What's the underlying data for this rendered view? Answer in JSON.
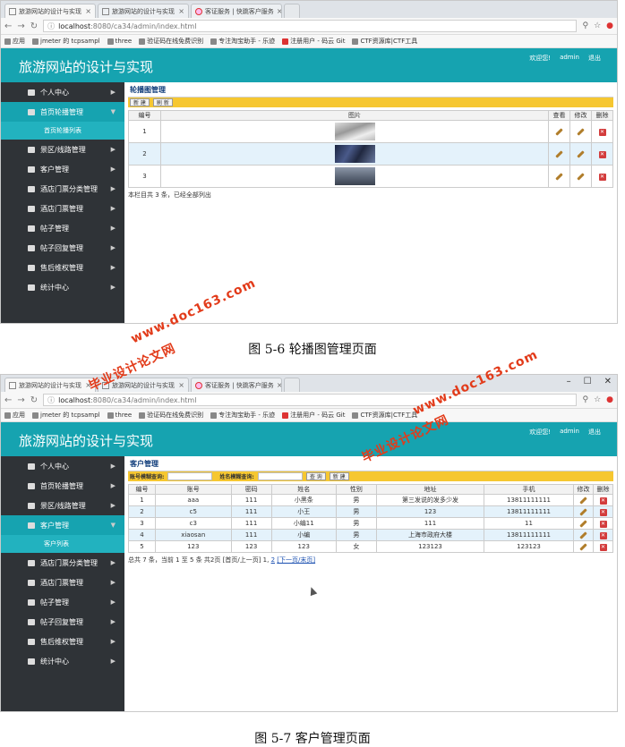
{
  "browser": {
    "tabs": [
      "旅游网站的设计与实现",
      "旅游网站的设计与实现",
      "客证服务 | 快跳客户服务"
    ],
    "address_host": "localhost",
    "address_path": ":8080/ca34/admin/index.html",
    "bookmarks": [
      "应用",
      "jmeter 的 tcpsampl",
      "three",
      "验证码在线免费识别",
      "专注淘宝助手 - 乐迹",
      "注册用户 - 码云 Git",
      "CTF资源库|CTF工具"
    ]
  },
  "header": {
    "title": "旅游网站的设计与实现",
    "welcome": "欢迎您!",
    "user": "admin",
    "logout": "退出"
  },
  "sidebar": {
    "items": [
      "个人中心",
      "首页轮播管理",
      "景区/线路管理",
      "客户管理",
      "酒店门票分类管理",
      "酒店门票管理",
      "帖子管理",
      "帖子回复管理",
      "售后维权管理",
      "统计中心"
    ],
    "sub_carousel": "首页轮播列表",
    "sub_customer": "客户列表"
  },
  "screen1": {
    "page_title": "轮播图管理",
    "btn_new": "新 建",
    "btn_refresh": "刷 新",
    "headers": [
      "编号",
      "图片",
      "查看",
      "修改",
      "删除"
    ],
    "rows": [
      "1",
      "2",
      "3"
    ],
    "summary": "本栏目共 3 条，已经全部列出"
  },
  "screen2": {
    "page_title": "客户管理",
    "search_account_label": "账号模糊查询:",
    "search_name_label": "姓名模糊查询:",
    "btn_search": "查 询",
    "btn_new": "新 建",
    "headers": [
      "编号",
      "账号",
      "密码",
      "姓名",
      "性别",
      "地址",
      "手机",
      "修改",
      "删除"
    ],
    "rows": [
      [
        "1",
        "aaa",
        "111",
        "小黑条",
        "男",
        "第三发说的发多少发",
        "13811111111"
      ],
      [
        "2",
        "c5",
        "111",
        "小王",
        "男",
        "123",
        "13811111111"
      ],
      [
        "3",
        "c3",
        "111",
        "小编11",
        "男",
        "111",
        "11"
      ],
      [
        "4",
        "xiaosan",
        "111",
        "小编",
        "男",
        "上海市政府大楼",
        "13811111111"
      ],
      [
        "5",
        "123",
        "123",
        "123",
        "女",
        "123123",
        "123123"
      ]
    ],
    "pagination_text": "总共 7 条，当前 1 至 5 条 共2页 [首页/上一页] 1,",
    "page_two": "2",
    "next_last": "[下一页/末页]"
  },
  "captions": {
    "fig1": "图 5-6 轮播图管理页面",
    "fig2": "图 5-7 客户管理页面"
  },
  "watermarks": {
    "site": "www.doc163.com",
    "label": "毕业设计论文网"
  },
  "colors": {
    "header": "#16a3b0",
    "sidebar": "#2f3337",
    "toolbar": "#f6c731",
    "watermark": "#e23b1a"
  }
}
